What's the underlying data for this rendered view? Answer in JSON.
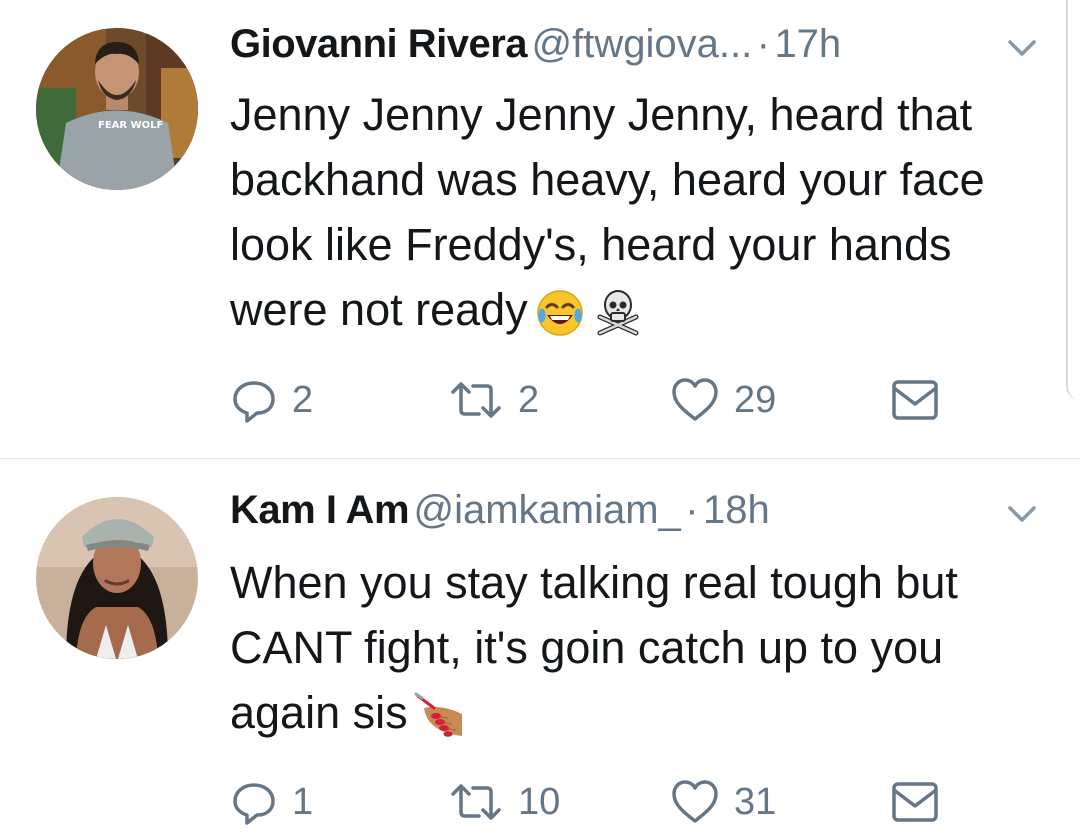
{
  "tweets": [
    {
      "name": "Giovanni Rivera",
      "handle": "@ftwgiova...",
      "separator": "·",
      "time": "17h",
      "text": "Jenny Jenny Jenny Jenny, heard that backhand was heavy, heard your face look like Freddy's, heard your hands were not ready",
      "emojis": [
        "face-with-tears-of-joy-emoji",
        "skull-and-crossbones-emoji"
      ],
      "avatar_shirt_text": "FEAR WOLF",
      "replies": "2",
      "retweets": "2",
      "likes": "29"
    },
    {
      "name": "Kam I Am",
      "handle": "@iamkamiam_",
      "separator": "·",
      "time": "18h",
      "text": "When you stay talking real tough but CANT fight, it's goin catch up to you again sis",
      "emojis": [
        "nail-polish-emoji"
      ],
      "replies": "1",
      "retweets": "10",
      "likes": "31"
    }
  ],
  "icons": [
    "reply-icon",
    "retweet-icon",
    "like-icon",
    "direct-message-icon",
    "chevron-down-icon"
  ],
  "colors": {
    "text": "#14171a",
    "secondary": "#657786",
    "divider": "#e1e8ed",
    "background": "#ffffff"
  }
}
